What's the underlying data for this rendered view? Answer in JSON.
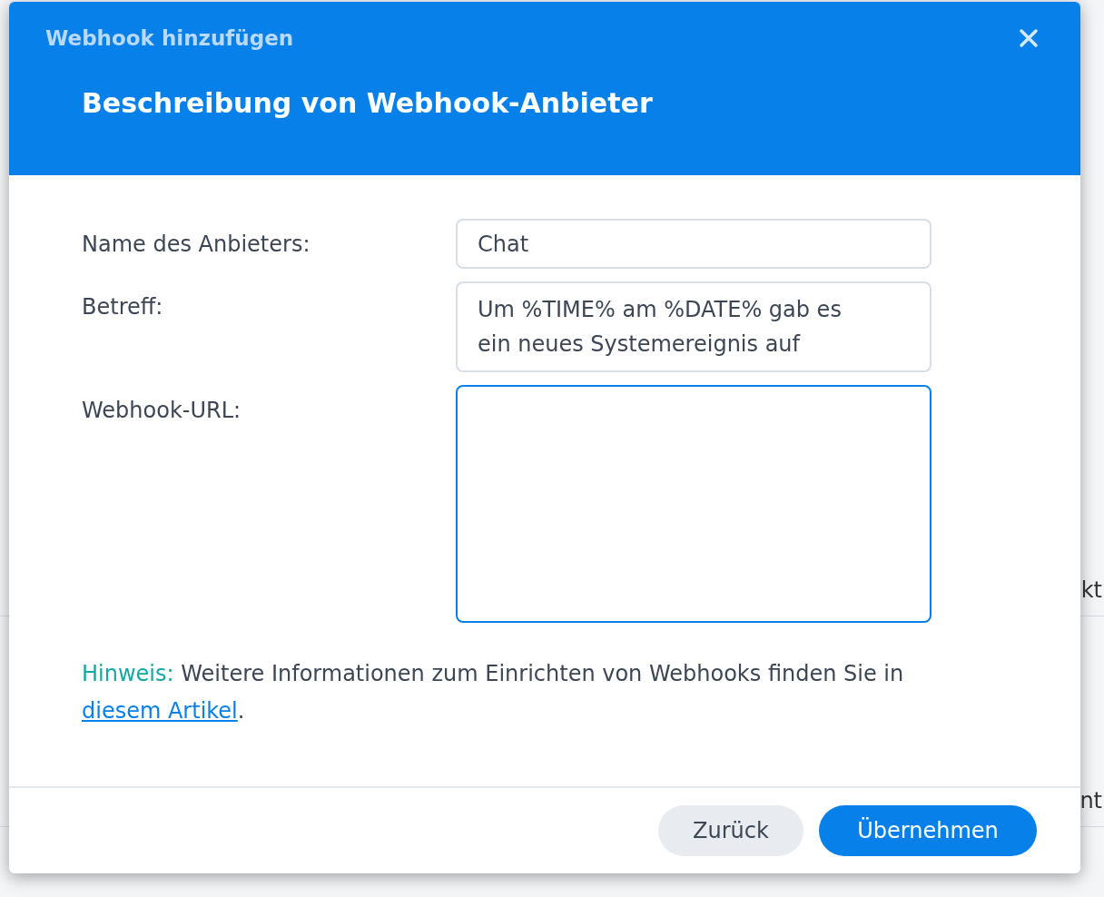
{
  "background": {
    "rows": [
      {
        "right": "kt"
      },
      {
        "right": "nt"
      }
    ]
  },
  "dialog": {
    "title": "Webhook hinzufügen",
    "heading": "Beschreibung von Webhook-Anbieter",
    "fields": [
      {
        "label": "Name des Anbieters:",
        "value": "Chat",
        "kind": "input",
        "focused": false
      },
      {
        "label": "Betreff:",
        "value": "Um %TIME% am %DATE% gab es ein neues Systemereignis auf",
        "kind": "textarea",
        "focused": false
      },
      {
        "label": "Webhook-URL:",
        "kind": "textarea-large",
        "focused": true
      }
    ],
    "hint": {
      "label": "Hinweis:",
      "text": "Weitere Informationen zum Einrichten von Webhooks finden Sie in",
      "link": "diesem Artikel",
      "after": "."
    },
    "buttons": [
      {
        "label": "Zurück",
        "primary": false
      },
      {
        "label": "Übernehmen",
        "primary": true
      }
    ]
  }
}
